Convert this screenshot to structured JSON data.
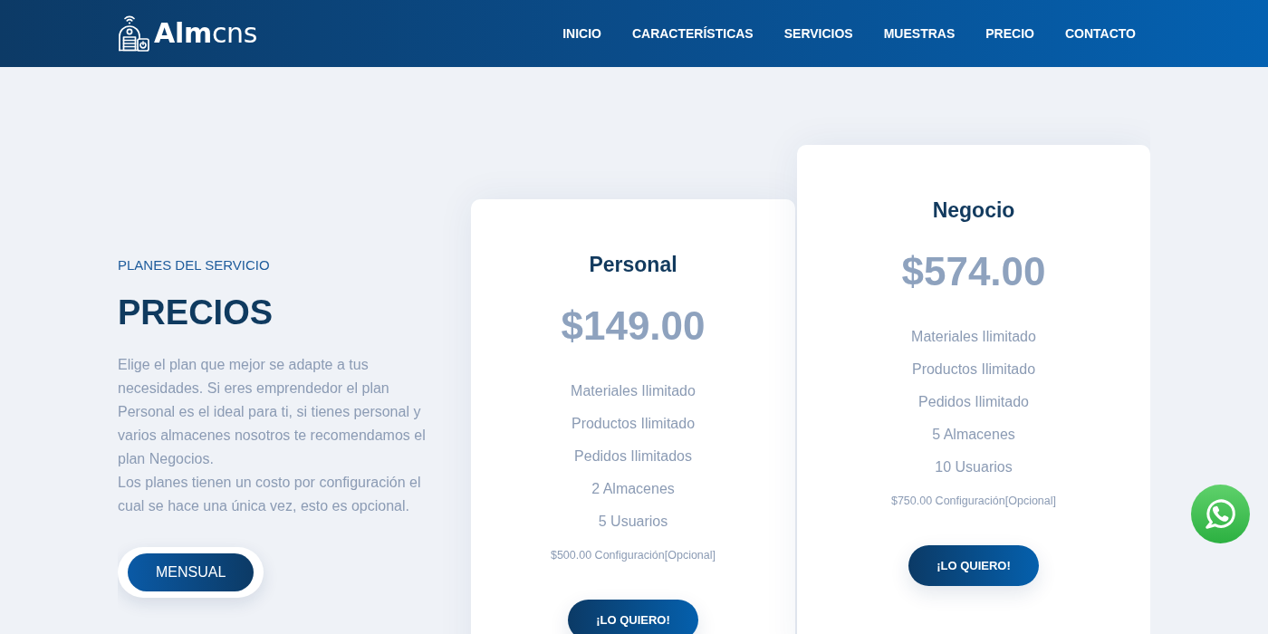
{
  "navbar": {
    "logo_text": "**Alm**cns",
    "links": [
      "INICIO",
      "CARACTERÍSTICAS",
      "SERVICIOS",
      "MUESTRAS",
      "PRECIO",
      "CONTACTO"
    ]
  },
  "pricing": {
    "eyebrow": "PLANES DEL SERVICIO",
    "heading": "PRECIOS",
    "description": [
      "Elige el plan que mejor se adapte a tus necesidades. Si eres emprendedor el plan Personal es el ideal para ti, si tienes personal y varios almacenes nosotros te recomendamos el plan Negocios.",
      "Los planes tienen un costo por configuración el cual se hace una única vez, esto es opcional."
    ],
    "billing_options": [
      {
        "label": "MENSUAL",
        "selected": true
      }
    ]
  },
  "plans": [
    {
      "name": "Personal",
      "featured": false,
      "price": "$149.00",
      "features": [
        "Materiales Ilimitado",
        "Productos Ilimitado",
        "Pedidos Ilimitados",
        "2 Almacenes",
        "5 Usuarios"
      ],
      "setup_fee": "$500.00 Configuración[Opcional]",
      "button": "¡LO QUIERO!"
    },
    {
      "name": "Negocio",
      "featured": true,
      "price": "$574.00",
      "features": [
        "Materiales Ilimitado",
        "Productos Ilimitado",
        "Pedidos Ilimitado",
        "5 Almacenes",
        "10 Usuarios"
      ],
      "setup_fee": "$750.00 Configuración[Opcional]",
      "button": "¡LO QUIERO!"
    }
  ]
}
